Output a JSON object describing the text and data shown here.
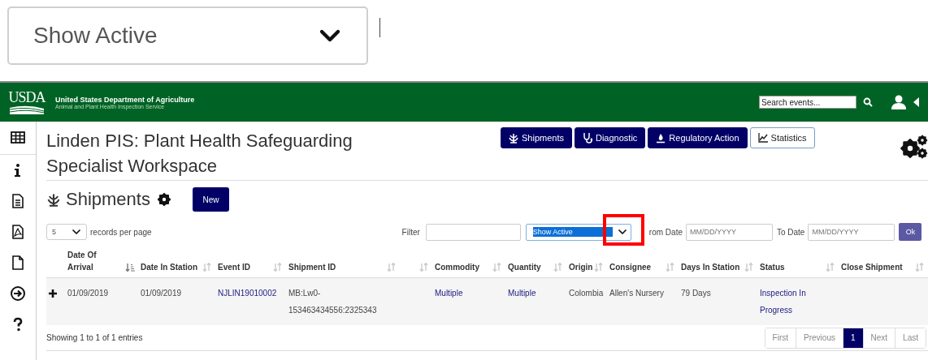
{
  "callout": {
    "value": "Show Active"
  },
  "header": {
    "logo": "USDA",
    "org": "United States Department of Agriculture",
    "agency": "Animal and Plant Health Inspection Service",
    "search_placeholder": "Search events..."
  },
  "page_title": "Linden PIS: Plant Health Safeguarding Specialist Workspace",
  "nav_buttons": [
    {
      "label": "Shipments",
      "kind": "filled"
    },
    {
      "label": "Diagnostic",
      "kind": "filled"
    },
    {
      "label": "Regulatory Action",
      "kind": "filled"
    },
    {
      "label": "Statistics",
      "kind": "outline"
    }
  ],
  "section": {
    "title": "Shipments",
    "new_button": "New"
  },
  "controls": {
    "page_size": "5",
    "page_size_label": "records per page",
    "filter_label": "Filter",
    "status_filter": "Show Active",
    "from_label": "rom Date",
    "from_placeholder": "MM/DD/YYYY",
    "to_label": "To Date",
    "to_placeholder": "MM/DD/YYYY",
    "ok_button": "Ok"
  },
  "table": {
    "columns": [
      {
        "label": "Date Of Arrival",
        "sorted": true
      },
      {
        "label": "Date In Station",
        "sorted": false
      },
      {
        "label": "Event ID",
        "sorted": false
      },
      {
        "label": "Shipment ID",
        "sorted": false
      },
      {
        "sorted": false
      },
      {
        "label": "Commodity",
        "sorted": false
      },
      {
        "label": "Quantity",
        "sorted": false
      },
      {
        "label": "Origin",
        "sorted": false
      },
      {
        "label": "Consignee",
        "sorted": false
      },
      {
        "label": "Days In Station",
        "sorted": false
      },
      {
        "label": "Status",
        "sorted": false
      },
      {
        "label": "Close Shipment",
        "sorted": false
      }
    ],
    "rows": [
      {
        "expanded": false,
        "cells": [
          {
            "text": "01/09/2019",
            "link": false
          },
          {
            "text": "01/09/2019",
            "link": false
          },
          {
            "text": "NJLIN19010002",
            "link": true
          },
          {
            "text": "MB:Lw0-153463434556:2325343",
            "link": false
          },
          "",
          {
            "text": "Multiple",
            "link": true
          },
          {
            "text": "Multiple",
            "link": true
          },
          {
            "text": "Colombia",
            "link": false
          },
          {
            "text": "Allen's Nursery",
            "link": false
          },
          {
            "text": "79 Days",
            "link": false
          },
          {
            "text": "Inspection In Progress",
            "link": true
          },
          ""
        ]
      }
    ]
  },
  "info": "Showing 1 to 1 of 1 entries",
  "pagination": [
    {
      "label": "First",
      "selected": false
    },
    {
      "label": "Previous",
      "selected": false
    },
    {
      "label": "1",
      "selected": true
    },
    {
      "label": "Next",
      "selected": false
    },
    {
      "label": "Last",
      "selected": false
    }
  ]
}
